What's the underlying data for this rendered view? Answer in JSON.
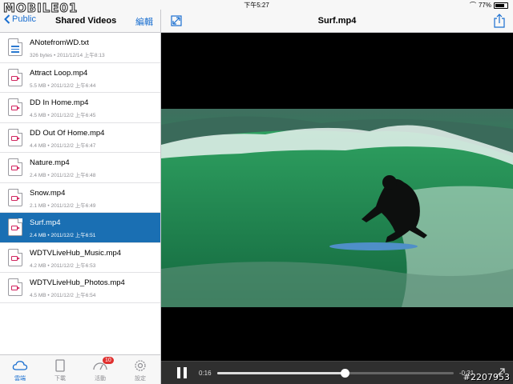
{
  "watermark": "MOBILE01",
  "photo_id": "#2207953",
  "status_bar": {
    "time": "下午5:27",
    "battery": "77%",
    "battery_level": 0.77
  },
  "sidebar": {
    "back_label": "Public",
    "title": "Shared Videos",
    "edit_label": "編輯",
    "files": [
      {
        "name": "ANotefromWD.txt",
        "meta": "326 bytes • 2011/12/14 上午8:13",
        "icon": "text-file-icon",
        "selected": false
      },
      {
        "name": "Attract Loop.mp4",
        "meta": "5.5 MB • 2011/12/2 上午6:44",
        "icon": "video-file-icon",
        "selected": false
      },
      {
        "name": "DD In Home.mp4",
        "meta": "4.5 MB • 2011/12/2 上午6:45",
        "icon": "video-file-icon",
        "selected": false
      },
      {
        "name": "DD Out Of Home.mp4",
        "meta": "4.4 MB • 2011/12/2 上午6:47",
        "icon": "video-file-icon",
        "selected": false
      },
      {
        "name": "Nature.mp4",
        "meta": "2.4 MB • 2011/12/2 上午6:48",
        "icon": "video-file-icon",
        "selected": false
      },
      {
        "name": "Snow.mp4",
        "meta": "2.1 MB • 2011/12/2 上午6:49",
        "icon": "video-file-icon",
        "selected": false
      },
      {
        "name": "Surf.mp4",
        "meta": "2.4 MB • 2011/12/2 上午6:51",
        "icon": "video-file-icon",
        "selected": true
      },
      {
        "name": "WDTVLiveHub_Music.mp4",
        "meta": "4.2 MB • 2011/12/2 上午6:53",
        "icon": "video-file-icon",
        "selected": false
      },
      {
        "name": "WDTVLiveHub_Photos.mp4",
        "meta": "4.5 MB • 2011/12/2 上午6:54",
        "icon": "video-file-icon",
        "selected": false
      }
    ],
    "tabs": [
      {
        "label": "雲端",
        "icon": "cloud-icon",
        "active": true
      },
      {
        "label": "下載",
        "icon": "download-icon",
        "active": false
      },
      {
        "label": "活動",
        "icon": "activity-icon",
        "active": false,
        "badge": "10"
      },
      {
        "label": "設定",
        "icon": "gear-icon",
        "active": false
      }
    ]
  },
  "player": {
    "title": "Surf.mp4",
    "elapsed": "0:16",
    "remaining": "-0:31",
    "progress": 0.54
  },
  "colors": {
    "accent": "#1a6fd0",
    "selected_row": "#1a6fb3",
    "badge": "#e0302f",
    "video_icon": "#d0245f"
  }
}
